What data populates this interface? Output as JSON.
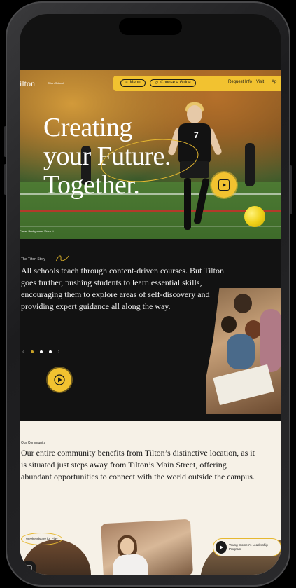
{
  "nav": {
    "brand": "ilton",
    "brand_sub": "Tilton School",
    "menu_label": "Menu",
    "guide_label": "Choose a Guide",
    "request_label": "Request Info",
    "visit_label": "Visit",
    "apply_label": "Ap"
  },
  "hero": {
    "headline": [
      "Creating",
      "your Future.",
      "Together."
    ],
    "player_number": "7",
    "pause_label": "Pause Background Video"
  },
  "story": {
    "eyebrow": "The Tilton Story",
    "body": "All schools teach through content-driven courses. But Tilton goes further, pushing students to learn essential skills, encouraging them to explore areas of self-discovery and providing expert guidance all along the way.",
    "carousel_prev": "‹",
    "carousel_next": "›"
  },
  "community": {
    "eyebrow": "Our Community",
    "body": "Our entire community benefits from Tilton’s distinctive location, as it is situated just steps away from Tilton’s Main Street, offering abundant opportunities to connect with the world outside the campus.",
    "weekends_label": "Weekends are for Play",
    "leadership_label": "Young Women's Leadership Program"
  },
  "colors": {
    "accent": "#f2c230",
    "dark": "#121212",
    "cream": "#f6f1e7"
  }
}
